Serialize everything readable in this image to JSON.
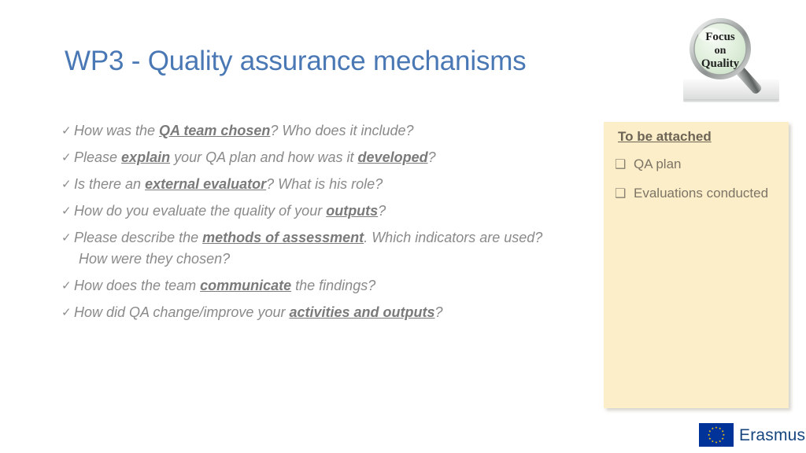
{
  "slide": {
    "title": "WP3 - Quality assurance mechanisms",
    "title_color": "#4a78b5",
    "background_color": "#ffffff"
  },
  "bullets": {
    "marker": "✓",
    "text_color": "#8a8a8a",
    "items": [
      {
        "id": "qa-team-chosen",
        "parts": [
          {
            "t": "How was the ",
            "em": false
          },
          {
            "t": "QA team chosen",
            "em": true
          },
          {
            "t": "? Who does it include?",
            "em": false
          }
        ]
      },
      {
        "id": "explain-qa-plan",
        "parts": [
          {
            "t": "Please ",
            "em": false
          },
          {
            "t": "explain",
            "em": true
          },
          {
            "t": " your QA plan and how was it ",
            "em": false
          },
          {
            "t": "developed",
            "em": true
          },
          {
            "t": "?",
            "em": false
          }
        ]
      },
      {
        "id": "external-evaluator",
        "parts": [
          {
            "t": "Is there an ",
            "em": false
          },
          {
            "t": "external evaluator",
            "em": true
          },
          {
            "t": "? What is his role?",
            "em": false
          }
        ]
      },
      {
        "id": "evaluate-outputs",
        "parts": [
          {
            "t": "How do you evaluate the quality of your ",
            "em": false
          },
          {
            "t": "outputs",
            "em": true
          },
          {
            "t": "?",
            "em": false
          }
        ]
      },
      {
        "id": "methods-of-assessment",
        "parts": [
          {
            "t": "Please describe the ",
            "em": false
          },
          {
            "t": "methods of assessment",
            "em": true
          },
          {
            "t": ". Which indicators are used?",
            "em": false
          }
        ],
        "second_line": "How were they chosen?"
      },
      {
        "id": "communicate-findings",
        "parts": [
          {
            "t": "How does the team ",
            "em": false
          },
          {
            "t": "communicate",
            "em": true
          },
          {
            "t": " the findings?",
            "em": false
          }
        ]
      },
      {
        "id": "qa-change-improve",
        "parts": [
          {
            "t": "How did QA change/improve your ",
            "em": false
          },
          {
            "t": "activities and outputs",
            "em": true
          },
          {
            "t": "?",
            "em": false
          }
        ]
      }
    ]
  },
  "side_panel": {
    "title": "To be attached",
    "background_color": "#fbeec9",
    "text_color": "#7d7466",
    "checkbox_glyph": "❑",
    "items": [
      {
        "id": "qa-plan",
        "label": "QA plan"
      },
      {
        "id": "evaluations-conducted",
        "label": "Evaluations conducted"
      }
    ]
  },
  "magnifier": {
    "icon": "magnifying-glass-icon",
    "lens_lines": [
      "Focus",
      "on",
      "Quality"
    ],
    "lens_color": "#e4efe0",
    "rim_color": "#b8bcba",
    "handle_color": "#9a9e9d"
  },
  "erasmus_logo": {
    "icon": "eu-flag-icon",
    "word": "Erasmus+",
    "flag_color": "#003399",
    "star_color": "#ffcc00",
    "word_color": "#17467f"
  }
}
